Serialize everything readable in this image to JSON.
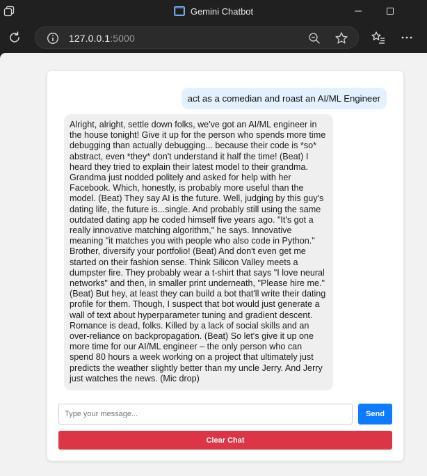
{
  "window": {
    "title": "Gemini Chatbot",
    "controls": [
      "minimize",
      "maximize",
      "close"
    ]
  },
  "toolbar": {
    "url_host": "127.0.0.1",
    "url_port": ":5000",
    "icons": [
      "refresh-icon",
      "info-icon",
      "zoom-out-icon",
      "star-icon",
      "favorites-icon",
      "more-icon"
    ]
  },
  "chat": {
    "messages": [
      {
        "role": "user",
        "text": "act as a comedian and roast an AI/ML Engineer"
      },
      {
        "role": "bot",
        "text": "Alright, alright, settle down folks, we've got an AI/ML engineer in the house tonight! Give it up for the person who spends more time debugging than actually debugging... because their code is *so* abstract, even *they* don't understand it half the time! (Beat) I heard they tried to explain their latest model to their grandma. Grandma just nodded politely and asked for help with her Facebook. Which, honestly, is probably more useful than the model. (Beat) They say AI is the future. Well, judging by this guy's dating life, the future is...single. And probably still using the same outdated dating app he coded himself five years ago. \"It's got a really innovative matching algorithm,\" he says. Innovative meaning \"it matches you with people who also code in Python.\" Brother, diversify your portfolio! (Beat) And don't even get me started on their fashion sense. Think Silicon Valley meets a dumpster fire. They probably wear a t-shirt that says \"I love neural networks\" and then, in smaller print underneath, \"Please hire me.\" (Beat) But hey, at least they can build a bot that'll write their dating profile for them. Though, I suspect that bot would just generate a wall of text about hyperparameter tuning and gradient descent. Romance is dead, folks. Killed by a lack of social skills and an over-reliance on backpropagation. (Beat) So let's give it up one more time for our AI/ML engineer – the only person who can spend 80 hours a week working on a project that ultimately just predicts the weather slightly better than my uncle Jerry. And Jerry just watches the news. (Mic drop)"
      }
    ]
  },
  "input": {
    "placeholder": "Type your message...",
    "value": "",
    "send_label": "Send",
    "clear_label": "Clear Chat"
  },
  "colors": {
    "user_bubble": "#e3f0fd",
    "bot_bubble": "#efefef",
    "send_button": "#0d7bff",
    "clear_button": "#dc3545"
  }
}
